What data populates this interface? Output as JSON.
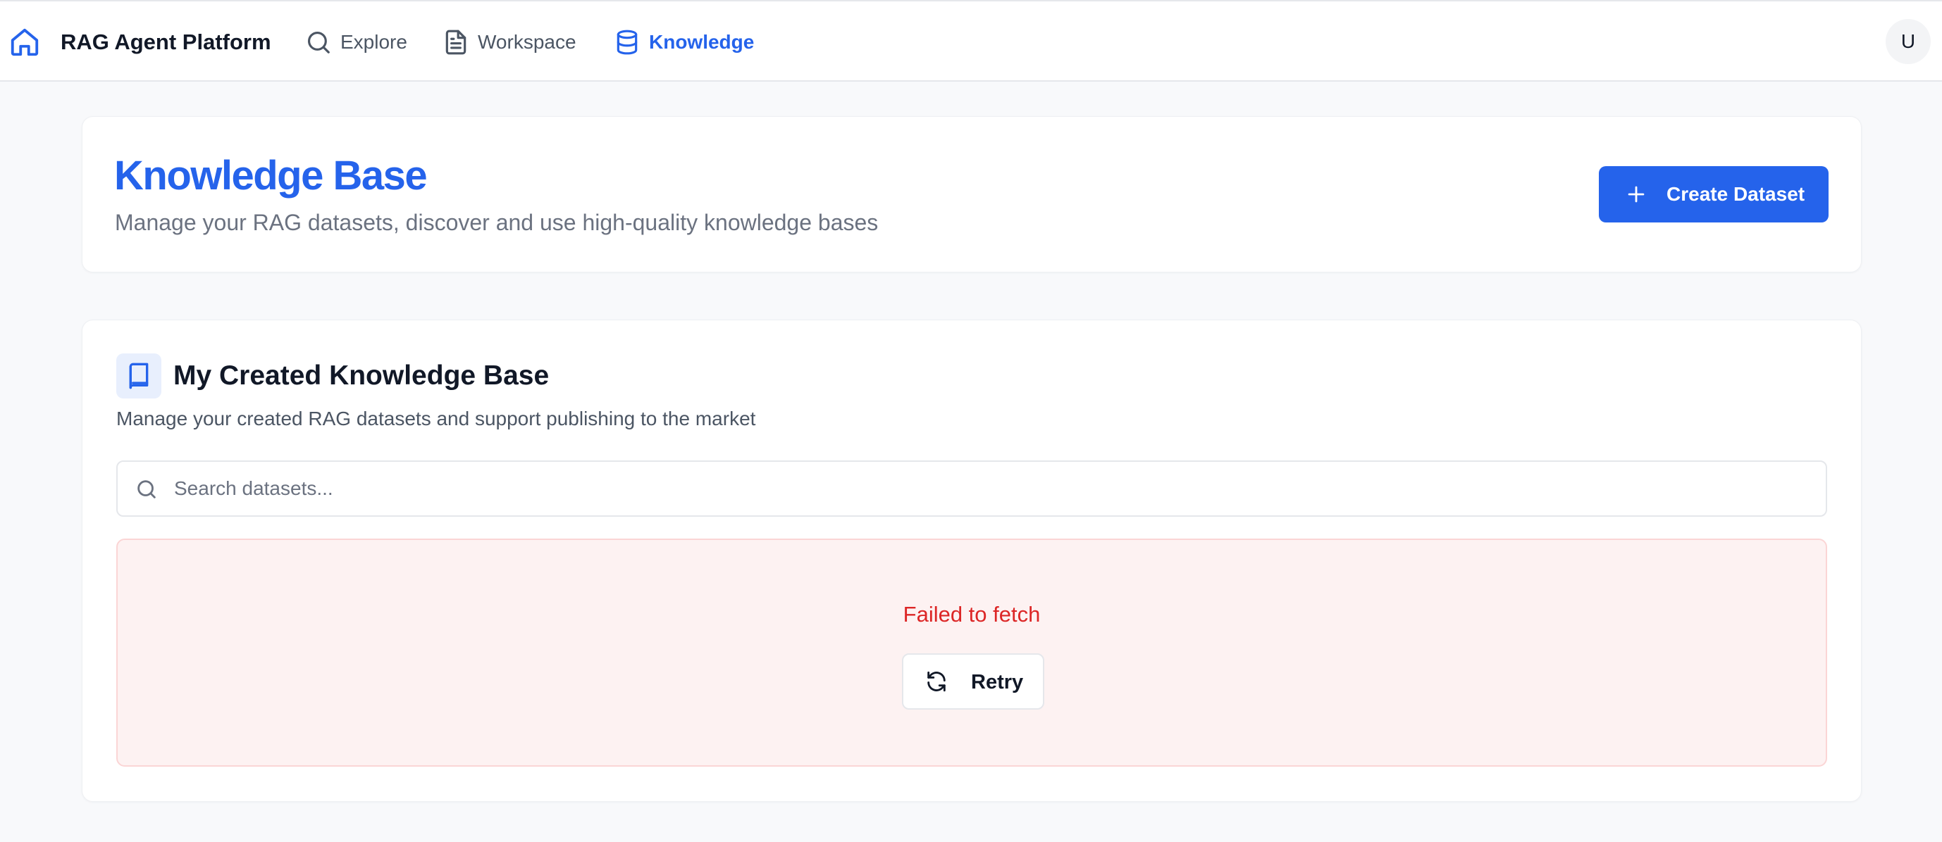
{
  "app": {
    "name": "RAG Agent Platform",
    "brand_icon": "home-icon",
    "accent_color": "#2563eb"
  },
  "nav": {
    "items": [
      {
        "label": "Explore",
        "icon": "search-icon",
        "active": false
      },
      {
        "label": "Workspace",
        "icon": "document-icon",
        "active": false
      },
      {
        "label": "Knowledge",
        "icon": "database-icon",
        "active": true
      }
    ]
  },
  "user": {
    "avatar_initial": "U"
  },
  "header": {
    "title": "Knowledge Base",
    "subtitle": "Manage your RAG datasets, discover and use high-quality knowledge bases",
    "create_button_label": "Create Dataset",
    "create_button_icon": "plus-icon"
  },
  "section": {
    "icon": "book-icon",
    "title": "My Created Knowledge Base",
    "subtitle": "Manage your created RAG datasets and support publishing to the market",
    "search": {
      "placeholder": "Search datasets...",
      "value": ""
    },
    "error": {
      "message": "Failed to fetch",
      "retry_label": "Retry",
      "retry_icon": "refresh-icon",
      "error_color": "#dc2626"
    }
  }
}
